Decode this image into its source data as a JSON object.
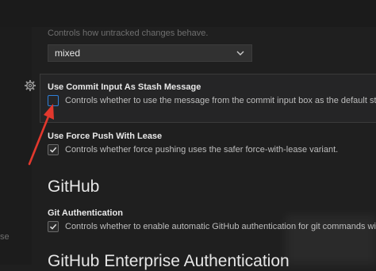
{
  "top_setting": {
    "description": "Controls how untracked changes behave.",
    "select_value": "mixed"
  },
  "commit_input_stash": {
    "title": "Use Commit Input As Stash Message",
    "description": "Controls whether to use the message from the commit input box as the default stash",
    "checked": false
  },
  "force_push_lease": {
    "title": "Use Force Push With Lease",
    "description": "Controls whether force pushing uses the safer force-with-lease variant.",
    "checked": true
  },
  "github_section": {
    "heading": "GitHub",
    "auth_title": "Git Authentication",
    "auth_description": "Controls whether to enable automatic GitHub authentication for git commands withi",
    "auth_checked": true
  },
  "enterprise_section": {
    "heading": "GitHub Enterprise Authentication"
  },
  "left_panel_fragment": "se",
  "colors": {
    "accent": "#2f7fd8",
    "arrow": "#e2382d"
  },
  "icons": [
    "gear-icon",
    "chevron-down-icon",
    "checkmark-icon"
  ]
}
